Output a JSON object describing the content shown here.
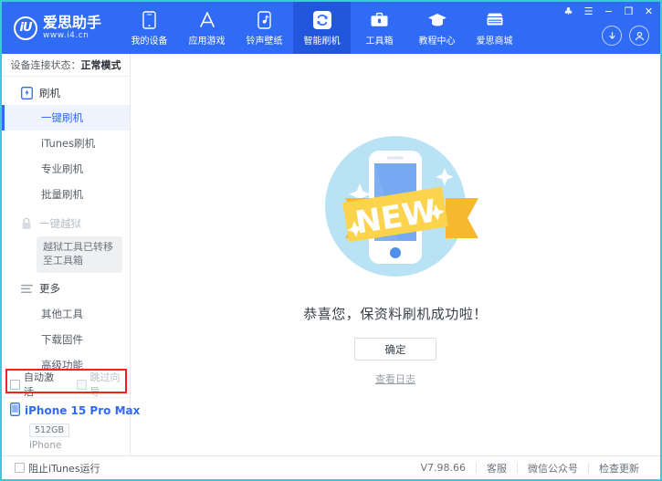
{
  "header": {
    "logo": {
      "mark": "iU",
      "name": "爱思助手",
      "url": "www.i4.cn"
    },
    "nav": [
      {
        "label": "我的设备",
        "icon": "phone-icon",
        "active": false
      },
      {
        "label": "应用游戏",
        "icon": "appstore-icon",
        "active": false
      },
      {
        "label": "铃声壁纸",
        "icon": "music-icon",
        "active": false
      },
      {
        "label": "智能刷机",
        "icon": "refresh-icon",
        "active": true
      },
      {
        "label": "工具箱",
        "icon": "toolbox-icon",
        "active": false
      },
      {
        "label": "教程中心",
        "icon": "graduation-cap-icon",
        "active": false
      },
      {
        "label": "爱思商城",
        "icon": "store-icon",
        "active": false
      }
    ],
    "window_controls": [
      {
        "name": "skin-icon",
        "glyph": "♣"
      },
      {
        "name": "menu-icon",
        "glyph": "☰"
      },
      {
        "name": "minimize-icon",
        "glyph": "−"
      },
      {
        "name": "maximize-icon",
        "glyph": "❐"
      },
      {
        "name": "close-icon",
        "glyph": "✕"
      }
    ],
    "account": [
      {
        "name": "download-icon",
        "glyph": "↓"
      },
      {
        "name": "user-avatar-icon",
        "glyph": "☻"
      }
    ]
  },
  "sidebar": {
    "connection_label": "设备连接状态：",
    "connection_value": "正常模式",
    "groups": [
      {
        "title": "刷机",
        "icon": "phone-flash-icon",
        "muted": false,
        "items": [
          {
            "label": "一键刷机",
            "active": true
          },
          {
            "label": "iTunes刷机",
            "active": false
          },
          {
            "label": "专业刷机",
            "active": false
          },
          {
            "label": "批量刷机",
            "active": false
          }
        ]
      },
      {
        "title": "一键越狱",
        "icon": "lock-icon",
        "muted": true,
        "tooltip": "越狱工具已转移至工具箱",
        "items": []
      },
      {
        "title": "更多",
        "icon": "list-icon",
        "muted": false,
        "items": [
          {
            "label": "其他工具",
            "active": false
          },
          {
            "label": "下载固件",
            "active": false
          },
          {
            "label": "高级功能",
            "active": false
          }
        ]
      }
    ],
    "checkboxes": [
      {
        "label": "自动激活",
        "checked": false,
        "disabled": false
      },
      {
        "label": "跳过向导",
        "checked": false,
        "disabled": true
      }
    ],
    "device": {
      "icon": "phone-icon",
      "name": "iPhone 15 Pro Max",
      "capacity": "512GB",
      "type": "iPhone"
    }
  },
  "main": {
    "illustration": "new-badge-phone-illustration",
    "badge_text": "NEW",
    "message": "恭喜您，保资料刷机成功啦！",
    "confirm_label": "确定",
    "log_link": "查看日志"
  },
  "statusbar": {
    "block_itunes_label": "阻止iTunes运行",
    "block_itunes_checked": false,
    "version": "V7.98.66",
    "links": [
      "客服",
      "微信公众号",
      "检查更新"
    ]
  },
  "colors": {
    "brand_blue": "#2f6bf5",
    "active_tab": "#2257dd",
    "window_border": "#3ec8d8",
    "highlight_red": "#ff1f1f",
    "badge_yellow": "#fbd34c",
    "illustration_circle": "#b9e3f5"
  }
}
